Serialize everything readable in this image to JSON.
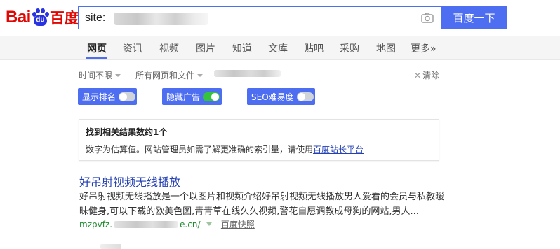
{
  "logo": {
    "part1": "Bai",
    "paw_text": "du",
    "part2": "百度"
  },
  "search": {
    "query_prefix": "site:",
    "button_label": "百度一下",
    "camera_icon": "camera-icon"
  },
  "tabs": [
    {
      "label": "网页",
      "active": true
    },
    {
      "label": "资讯"
    },
    {
      "label": "视频"
    },
    {
      "label": "图片"
    },
    {
      "label": "知道"
    },
    {
      "label": "文库"
    },
    {
      "label": "贴吧"
    },
    {
      "label": "采购"
    },
    {
      "label": "地图"
    },
    {
      "label": "更多»"
    }
  ],
  "filters": {
    "time": "时间不限",
    "scope": "所有网页和文件",
    "clear": "清除"
  },
  "toggles": [
    {
      "label": "显示排名",
      "state": "off"
    },
    {
      "label": "隐藏广告",
      "state": "on"
    },
    {
      "label": "SEO难易度",
      "state": "off"
    }
  ],
  "info": {
    "title": "找到相关结果数约1个",
    "desc_prefix": "数字为估算值。网站管理员如需了解更准确的索引量，请使用",
    "link": "百度站长平台"
  },
  "result": {
    "title": "好吊射视频无线播放",
    "abstract": "好吊射视频无线播放是一个以图片和视频介绍好吊射视频无线播放男人爱看的会员与私教暧昧健身,可以下载的欧美色图,青青草在线久久视频,警花自愿调教成母狗的网站,男人...",
    "url_prefix": "mzpvfz.",
    "url_suffix": "e.cn/",
    "separator": "-",
    "snapshot": "百度快照"
  },
  "colors": {
    "brand_red": "#e10602",
    "brand_blue": "#2932e1",
    "accent": "#4e6ef2",
    "link": "#2440b3",
    "url_green": "#1e8b2e",
    "switch_on": "#35c23d"
  }
}
